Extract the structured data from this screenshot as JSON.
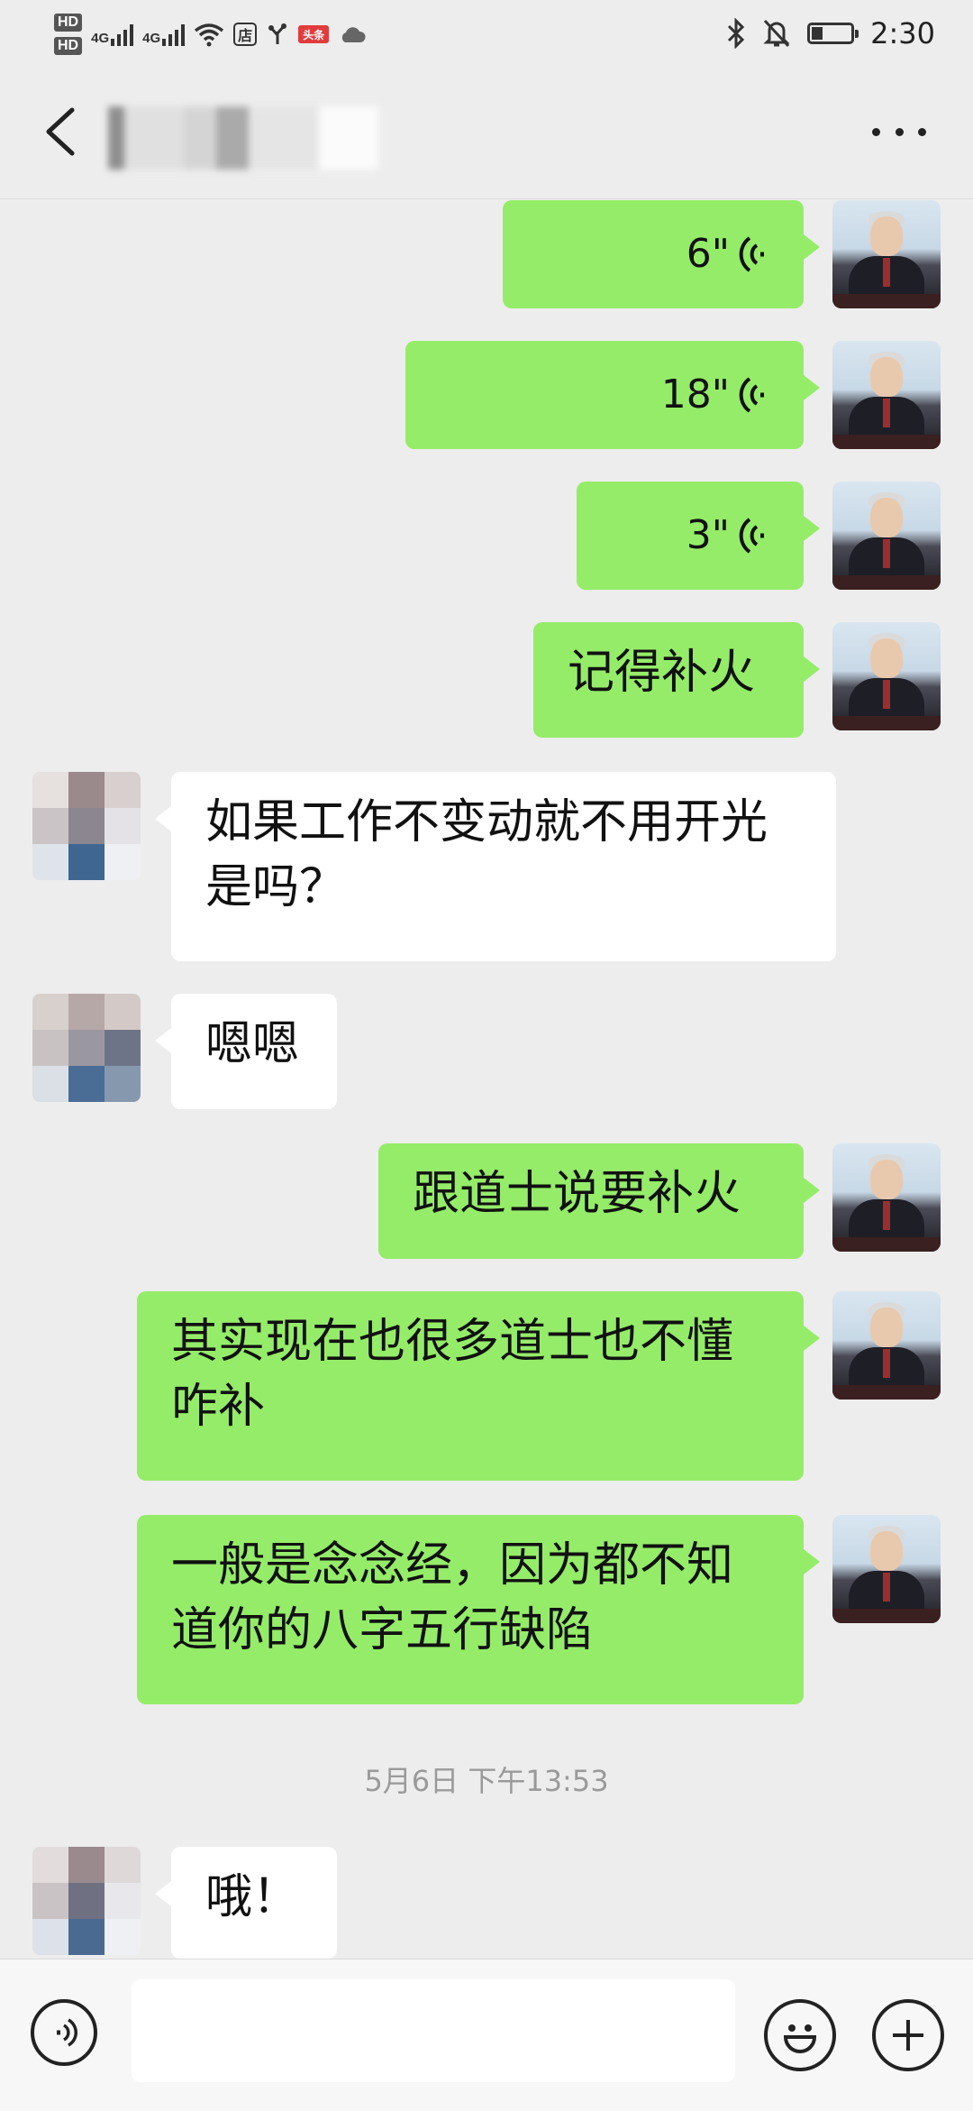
{
  "status_bar": {
    "hd1": "HD",
    "hd2": "HD",
    "sim1": "4G",
    "sim2": "4G",
    "app_shop": "店",
    "app_toutiao": "头条",
    "time": "2:30",
    "icons": [
      "wifi-icon",
      "bluetooth-icon",
      "mute-bell-icon",
      "battery-icon"
    ]
  },
  "header": {
    "contact_name": "",
    "back_icon": "chevron-left-icon",
    "more_icon": "more-dots-icon"
  },
  "messages": [
    {
      "side": "out",
      "type": "voice",
      "duration": "6\""
    },
    {
      "side": "out",
      "type": "voice",
      "duration": "18\""
    },
    {
      "side": "out",
      "type": "voice",
      "duration": "3\""
    },
    {
      "side": "out",
      "type": "text",
      "text": "记得补火"
    },
    {
      "side": "in",
      "type": "text",
      "line1": "如果工作不变动就不用开光",
      "line2": "是吗？"
    },
    {
      "side": "in",
      "type": "text",
      "text": "嗯嗯"
    },
    {
      "side": "out",
      "type": "text",
      "text": "跟道士说要补火"
    },
    {
      "side": "out",
      "type": "text",
      "line1": "其实现在也很多道士也不懂",
      "line2": "咋补"
    },
    {
      "side": "out",
      "type": "text",
      "line1": "一般是念念经，因为都不知",
      "line2": "道你的八字五行缺陷"
    },
    {
      "side": "in",
      "type": "text",
      "text": "哦！"
    }
  ],
  "timestamp": "5月6日 下午13:53",
  "input_bar": {
    "voice_icon": "voice-mode-icon",
    "emoji_icon": "emoji-icon",
    "plus_icon": "plus-icon",
    "input_value": ""
  },
  "colors": {
    "background": "#ededed",
    "outgoing_bubble": "#95ec69",
    "incoming_bubble": "#ffffff"
  }
}
